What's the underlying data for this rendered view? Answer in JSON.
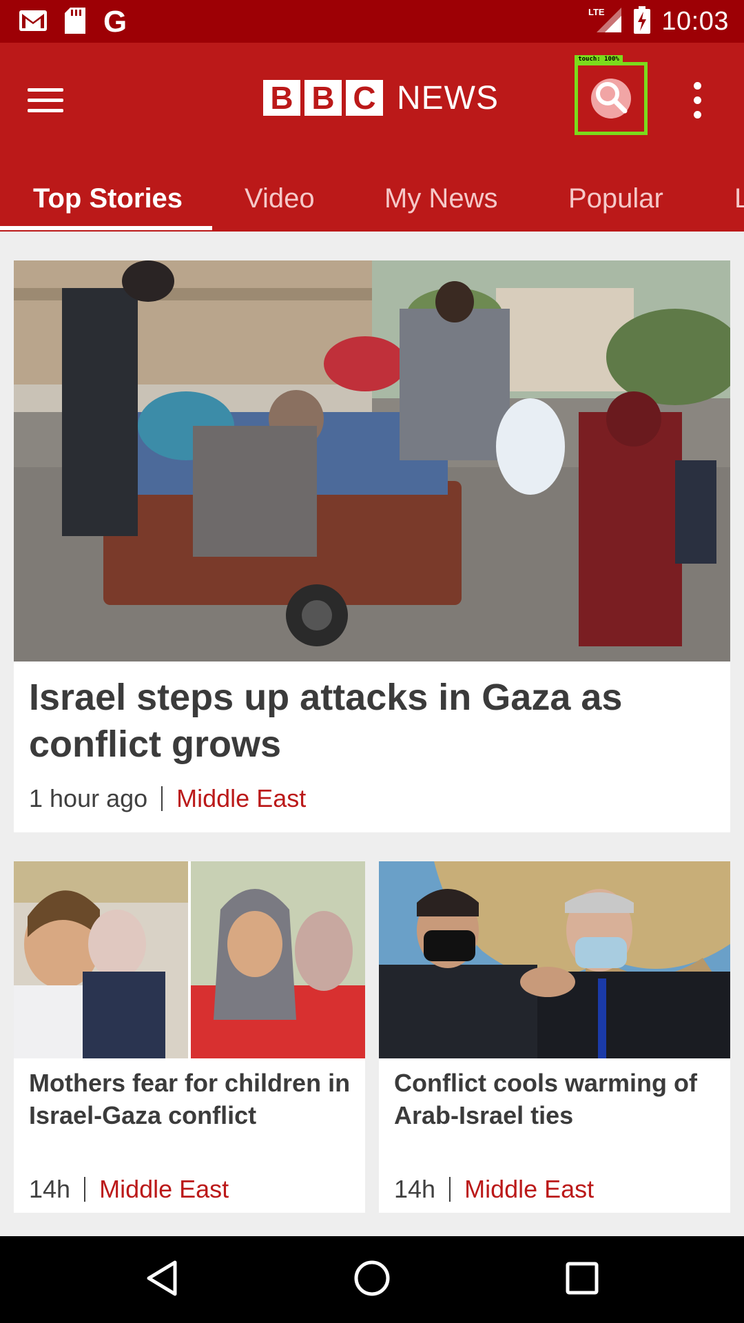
{
  "status_bar": {
    "time": "10:03",
    "network": "LTE",
    "left_icons": [
      "gmail-icon",
      "sd-card-icon",
      "google-icon"
    ],
    "google_letter": "G"
  },
  "app_bar": {
    "logo_letters": [
      "B",
      "B",
      "C"
    ],
    "logo_word": "NEWS",
    "touch_indicator": "touch: 100%"
  },
  "tabs": [
    {
      "label": "Top Stories",
      "active": true
    },
    {
      "label": "Video",
      "active": false
    },
    {
      "label": "My News",
      "active": false
    },
    {
      "label": "Popular",
      "active": false
    },
    {
      "label": "L",
      "active": false
    }
  ],
  "hero_story": {
    "title": "Israel steps up attacks in Gaza as conflict grows",
    "time": "1 hour ago",
    "category": "Middle East"
  },
  "stories": [
    {
      "title": "Mothers fear for children in Israel-Gaza conflict",
      "time": "14h",
      "category": "Middle East"
    },
    {
      "title": "Conflict cools warming of Arab-Israel ties",
      "time": "14h",
      "category": "Middle East"
    }
  ],
  "colors": {
    "status_bar": "#9d0005",
    "app_bar": "#bb1919",
    "category_text": "#bb1919",
    "touch_highlight": "#7cdb1c"
  }
}
